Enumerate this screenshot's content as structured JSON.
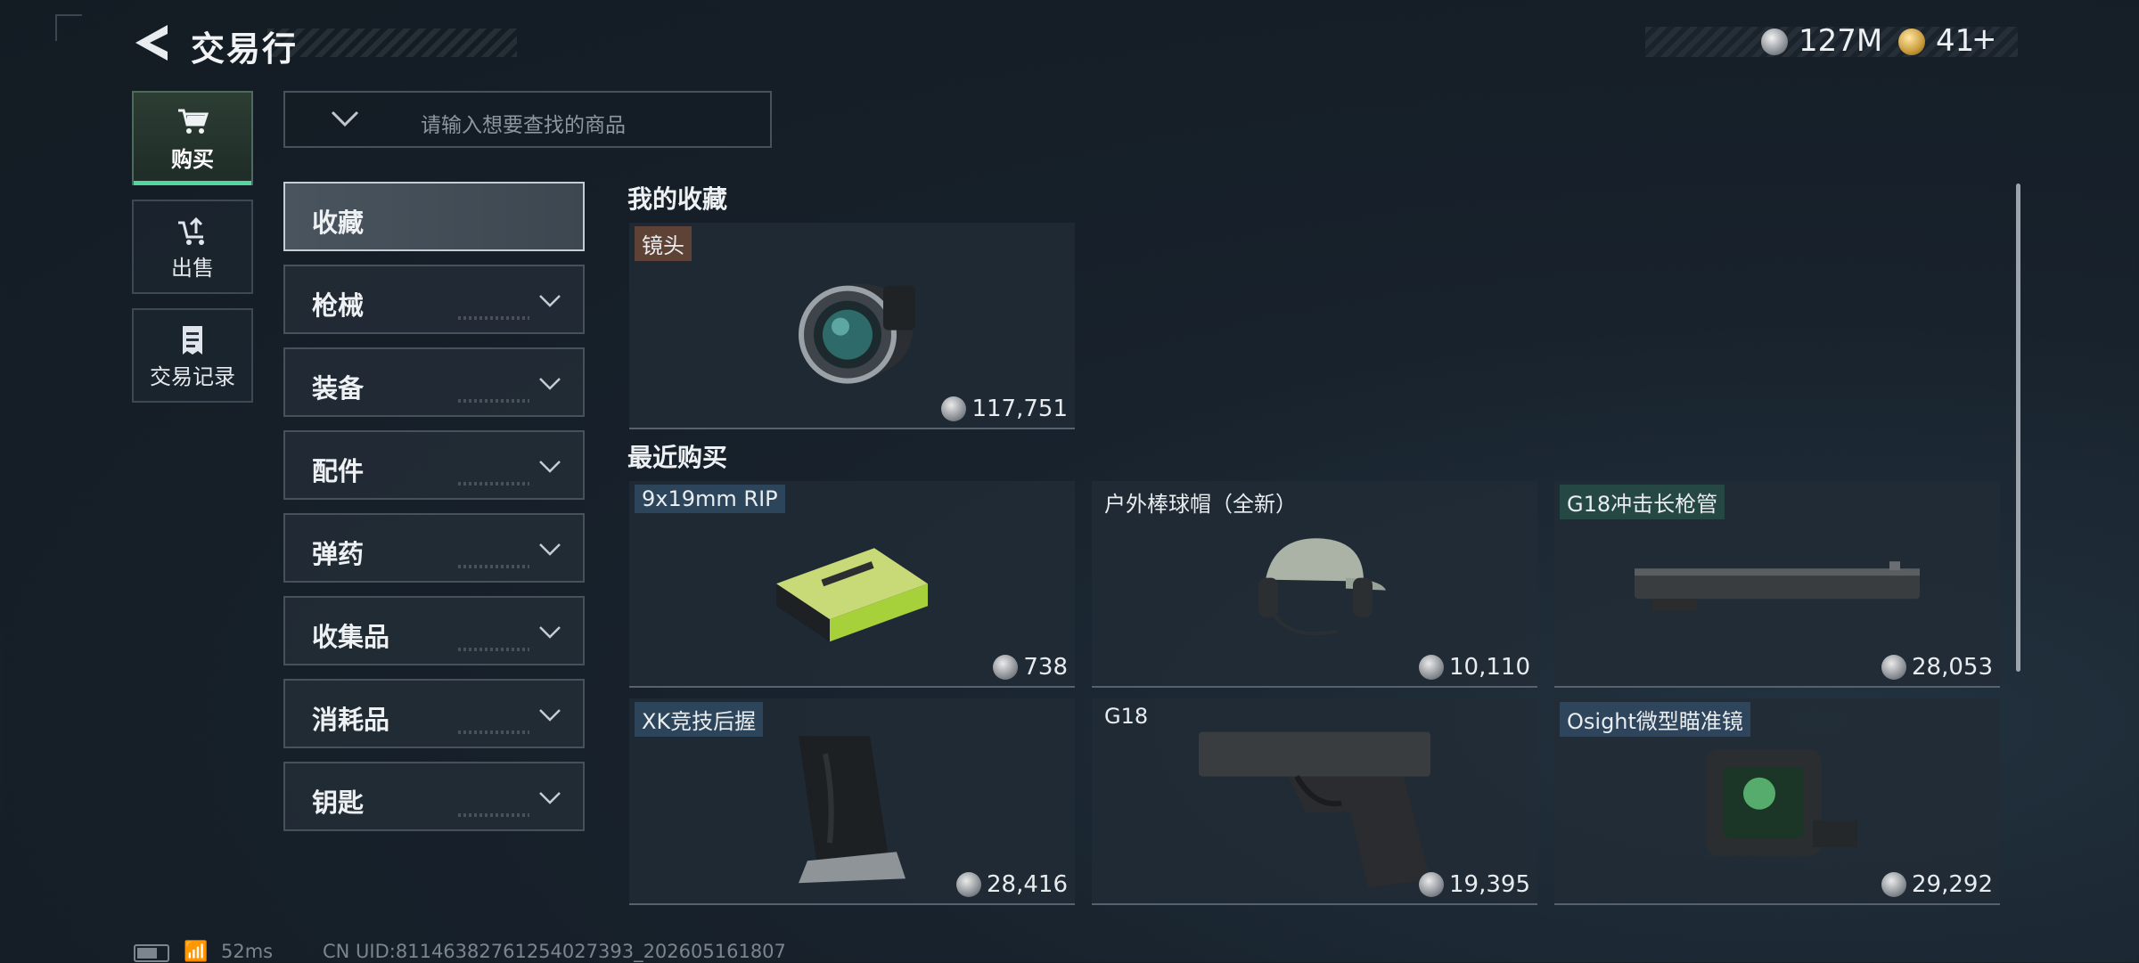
{
  "header": {
    "title": "交易行"
  },
  "currency": [
    {
      "name": "silver-coin",
      "value": "127M"
    },
    {
      "name": "gold-coin",
      "value": "41",
      "add_symbol": "+"
    }
  ],
  "nav": {
    "buy": {
      "label": "购买",
      "icon": "cart-icon"
    },
    "sell": {
      "label": "出售",
      "icon": "sell-cart-icon"
    },
    "history": {
      "label": "交易记录",
      "icon": "receipt-icon"
    }
  },
  "search": {
    "placeholder": "请输入想要查找的商品"
  },
  "categories": [
    {
      "label": "收藏",
      "active": true
    },
    {
      "label": "枪械"
    },
    {
      "label": "装备"
    },
    {
      "label": "配件"
    },
    {
      "label": "弹药"
    },
    {
      "label": "收集品"
    },
    {
      "label": "消耗品"
    },
    {
      "label": "钥匙"
    }
  ],
  "favorites": {
    "title": "我的收藏",
    "items": [
      {
        "name": "镜头",
        "price": "117,751",
        "image": "camera-lens"
      }
    ]
  },
  "recent": {
    "title": "最近购买",
    "items": [
      {
        "name": "9x19mm RIP",
        "price": "738",
        "image": "ammo-box"
      },
      {
        "name": "户外棒球帽（全新）",
        "price": "10,110",
        "image": "cap-headset"
      },
      {
        "name": "G18冲击长枪管",
        "price": "28,053",
        "image": "pistol-slide"
      },
      {
        "name": "XK竞技后握",
        "price": "28,416",
        "image": "pistol-grip"
      },
      {
        "name": "G18",
        "price": "19,395",
        "image": "pistol"
      },
      {
        "name": "Osight微型瞄准镜",
        "price": "29,292",
        "image": "red-dot-sight"
      }
    ]
  },
  "status": {
    "ping": "52ms",
    "uid": "CN UID:81146382761254027393_202605161807"
  },
  "colors": {
    "accent": "#52d6a0",
    "background": "#18222c"
  }
}
